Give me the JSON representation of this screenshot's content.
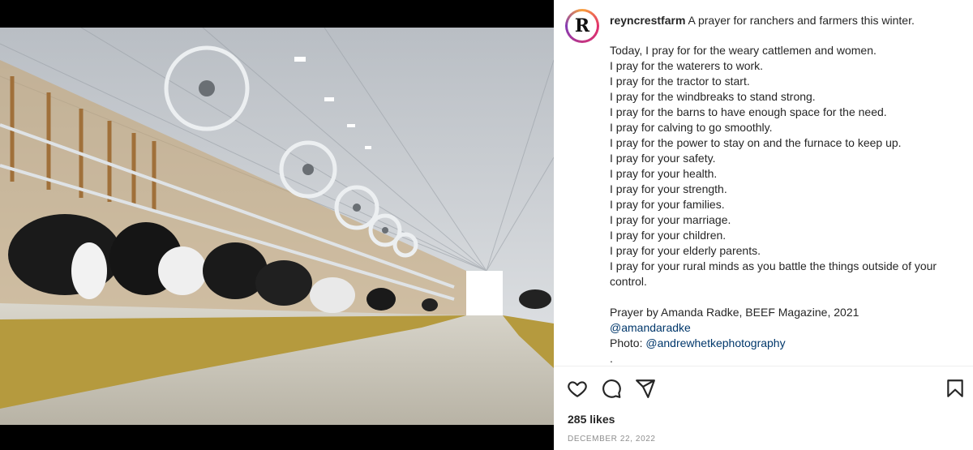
{
  "post": {
    "username": "reyncrestfarm",
    "caption_title": "A prayer for ranchers and farmers this winter.",
    "lines": [
      "Today, I pray for for the weary cattlemen and women.",
      "I pray for the waterers to work.",
      "I pray for the tractor to start.",
      "I pray for the windbreaks to stand strong.",
      "I pray for the barns to have enough space for the need.",
      "I pray for calving to go smoothly.",
      "I pray for the power to stay on and the furnace to keep up.",
      "I pray for your safety.",
      "I pray for your health.",
      "I pray for your strength.",
      "I pray for your families.",
      "I pray for your marriage.",
      "I pray for your children.",
      "I pray for your elderly parents.",
      "I pray for your rural minds as you battle the things outside of your control."
    ],
    "credit": "Prayer by Amanda Radke, BEEF Magazine, 2021",
    "mention": "@amandaradke",
    "photo_label": "Photo:",
    "photo_credit": "@andrewhetkephotography",
    "trailing": ".",
    "likes": "285 likes",
    "date": "DECEMBER 22, 2022",
    "avatar_letter": "R"
  },
  "icons": {
    "like": "heart-icon",
    "comment": "comment-icon",
    "share": "send-icon",
    "save": "bookmark-icon"
  }
}
